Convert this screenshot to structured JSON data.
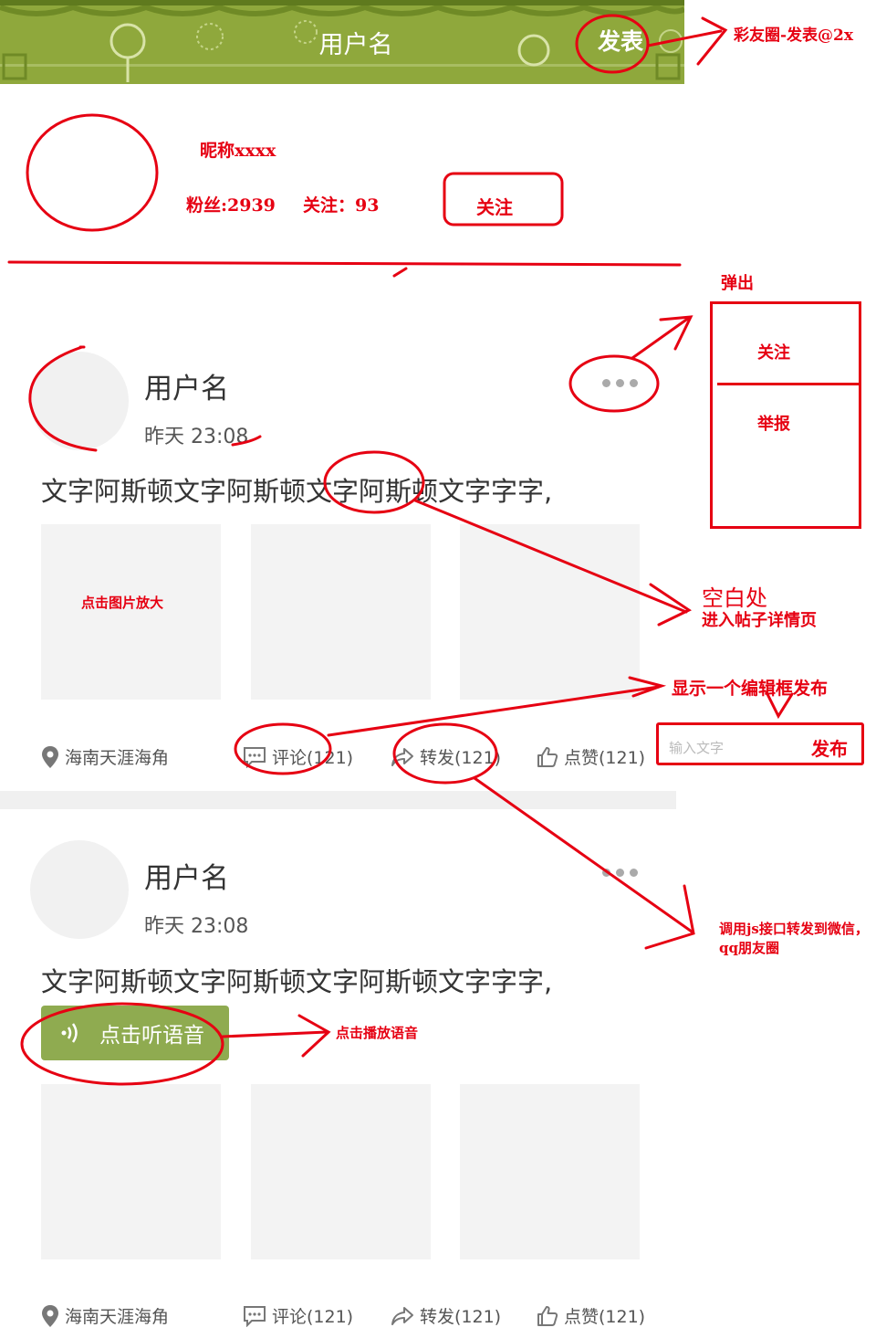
{
  "header": {
    "title": "用户名",
    "post_label": "发表"
  },
  "profile": {
    "nickname": "昵称xxxx",
    "fans": "粉丝:2939",
    "following": "关注：93",
    "follow_label": "关注"
  },
  "posts": [
    {
      "username": "用户名",
      "time": "昨天 23:08",
      "text": "文字阿斯顿文字阿斯顿文字阿斯顿文字字字,",
      "location": "海南天涯海角",
      "comment": "评论(121)",
      "share": "转发(121)",
      "like": "点赞(121)"
    },
    {
      "username": "用户名",
      "time": "昨天 23:08",
      "text": "文字阿斯顿文字阿斯顿文字阿斯顿文字字字,",
      "voice_label": "点击听语音",
      "location": "海南天涯海角",
      "comment": "评论(121)",
      "share": "转发(121)",
      "like": "点赞(121)"
    }
  ],
  "annotations": {
    "post_asset": "彩友圈-发表@2x",
    "popup_title": "弹出",
    "popup_follow": "关注",
    "popup_report": "举报",
    "image_tap": "点击图片放大",
    "blank_area_line1": "空白处",
    "blank_area_line2": "进入帖子详情页",
    "editbox_note": "显示一个编辑框发布",
    "edit_placeholder": "输入文字",
    "edit_send": "发布",
    "share_note": "调用js接口转发到微信，qq朋友圈",
    "voice_note": "点击播放语音"
  },
  "colors": {
    "header_green": "#8fa83c",
    "voice_green": "#8fab50",
    "annotation_red": "#e60012",
    "placeholder_gray": "#f3f3f3"
  }
}
